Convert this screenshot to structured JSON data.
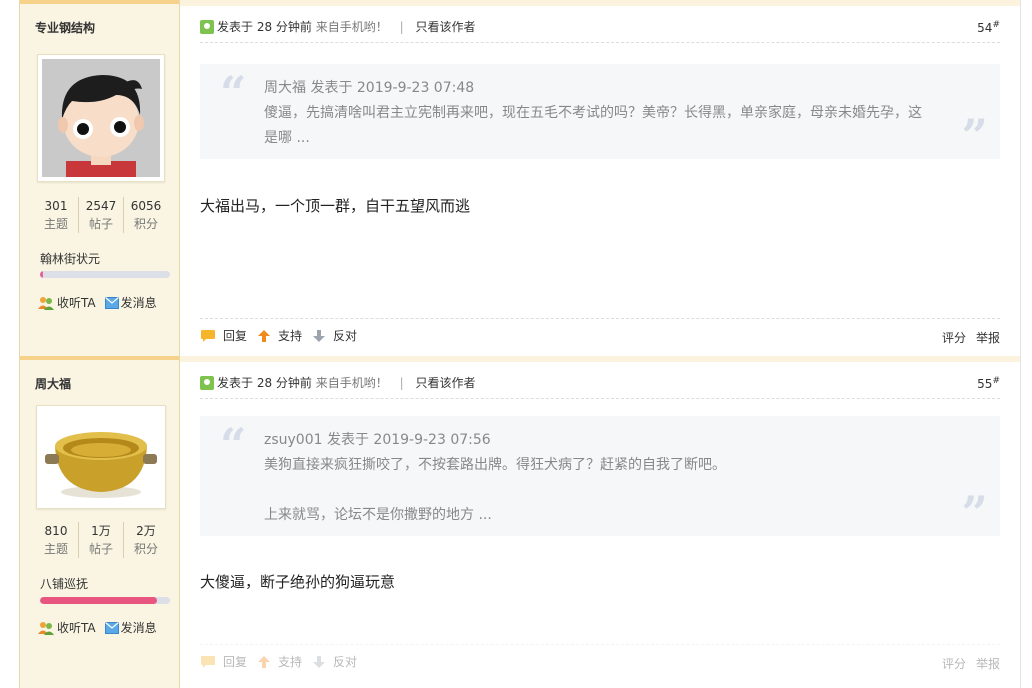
{
  "posts": [
    {
      "user": {
        "name": "专业钢结构",
        "stats": [
          {
            "num": "301",
            "label": "主题"
          },
          {
            "num": "2547",
            "label": "帖子"
          },
          {
            "num": "6056",
            "label": "积分"
          }
        ],
        "rank": "翰林街状元",
        "rank_progress": 0.02,
        "rank_color": "#e7609a"
      },
      "meta": {
        "posted": "发表于 28 分钟前",
        "device": "来自手机哟！",
        "sep": "|",
        "only_author": "只看该作者"
      },
      "floor": "54",
      "quote": {
        "header": "周大福 发表于 2019-9-23 07:48",
        "lines": [
          "傻逼，先搞清啥叫君主立宪制再来吧，现在五毛不考试的吗？美帝？长得黑，单亲家庭，母亲未婚先孕，这是哪 ..."
        ]
      },
      "message": "大福出马，一个顶一群，自干五望风而逃",
      "footer": {
        "reply": "回复",
        "support": "支持",
        "oppose": "反对",
        "rate": "评分",
        "report": "举报"
      }
    },
    {
      "user": {
        "name": "周大福",
        "stats": [
          {
            "num": "810",
            "label": "主题"
          },
          {
            "num": "1万",
            "label": "帖子"
          },
          {
            "num": "2万",
            "label": "积分"
          }
        ],
        "rank": "八铺巡抚",
        "rank_progress": 0.9,
        "rank_color": "#e8557f"
      },
      "meta": {
        "posted": "发表于 28 分钟前",
        "device": "来自手机哟！",
        "sep": "|",
        "only_author": "只看该作者"
      },
      "floor": "55",
      "quote": {
        "header": "zsuy001 发表于 2019-9-23 07:56",
        "lines": [
          "美狗直接来疯狂撕咬了，不按套路出牌。得狂犬病了？赶紧的自我了断吧。",
          "上来就骂，论坛不是你撒野的地方 ..."
        ]
      },
      "message": "大傻逼，断子绝孙的狗逼玩意",
      "footer": {
        "reply": "回复",
        "support": "支持",
        "oppose": "反对",
        "rate": "评分",
        "report": "举报"
      }
    }
  ],
  "sidebar_actions": {
    "follow": "收听TA",
    "message": "发消息"
  },
  "floor_suffix": "#",
  "colors": {
    "sidebar_bg": "#f9f5e2",
    "accent": "#f7d28a",
    "online": "#7ec24f"
  },
  "icons": {
    "online": "online-status-icon",
    "follow": "follow-user-icon",
    "mail": "mail-icon",
    "reply": "reply-bubble-icon",
    "support": "up-arrow-icon",
    "oppose": "down-arrow-icon"
  }
}
